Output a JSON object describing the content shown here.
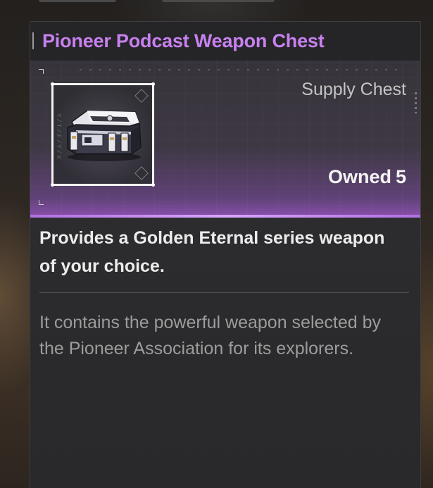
{
  "item": {
    "title": "Pioneer Podcast Weapon Chest",
    "type": "Supply Chest",
    "owned_label": "Owned",
    "owned_count": "5",
    "icon": "chest-icon",
    "frame_side_text": "Y/T/F/Y/X",
    "description": "Provides a Golden Eternal series weapon of your choice.",
    "lore": "It contains the powerful weapon selected by the Pioneer Association for its explorers."
  },
  "colors": {
    "title": "#c880f0",
    "accent_glow": "#b070e0",
    "description": "#ececec",
    "lore": "#9c9c9c"
  }
}
